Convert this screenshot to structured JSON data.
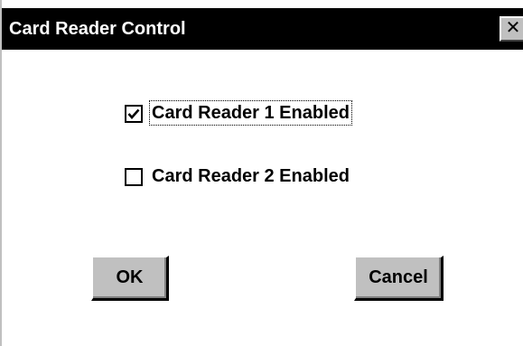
{
  "window": {
    "title": "Card Reader Control",
    "close_glyph": "✕",
    "close_icon": "close-icon"
  },
  "options": [
    {
      "label": "Card Reader 1 Enabled",
      "checked": true
    },
    {
      "label": "Card Reader 2 Enabled",
      "checked": false
    }
  ],
  "buttons": {
    "ok_label": "OK",
    "cancel_label": "Cancel"
  },
  "colors": {
    "titlebar": "#000000",
    "button_face": "#c0c0c0",
    "background": "#ffffff"
  }
}
